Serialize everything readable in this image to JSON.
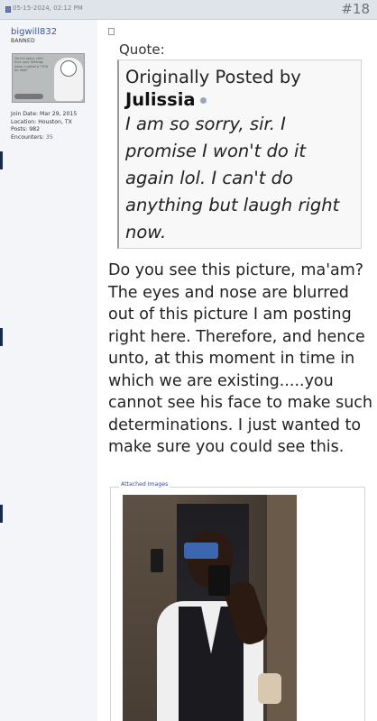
{
  "post": {
    "date": "05-15-2024, 02:12 PM",
    "number": "#18"
  },
  "user": {
    "name": "bigwill832",
    "title": "BANNED",
    "avatar_caption": "Oh I'm sorry, did I hurt your feelings when I called a \"YOU an idiot\"",
    "join_date": "Join Date: Mar 29, 2015",
    "location": "Location: Houston, TX",
    "posts": "Posts: 982",
    "encounters_label": "Encounters:",
    "encounters_value": "35"
  },
  "quote": {
    "label": "Quote:",
    "originally_posted_by": "Originally Posted by",
    "author": "Julissia",
    "text": "I am so sorry, sir. I promise I won't do it again lol. I can't do anything but laugh right now."
  },
  "message": "Do you see this picture, ma'am? The eyes and nose are blurred out of this picture I am posting right here. Therefore, and hence unto, at this moment in time in which we are existing.....you cannot see his face to make such determinations. I just wanted to make sure you could see this.",
  "attachments": {
    "legend": "Attached Images"
  },
  "icons": {
    "post_status": "document-icon",
    "post_link": "post-icon",
    "view_post": "view-post-icon"
  }
}
